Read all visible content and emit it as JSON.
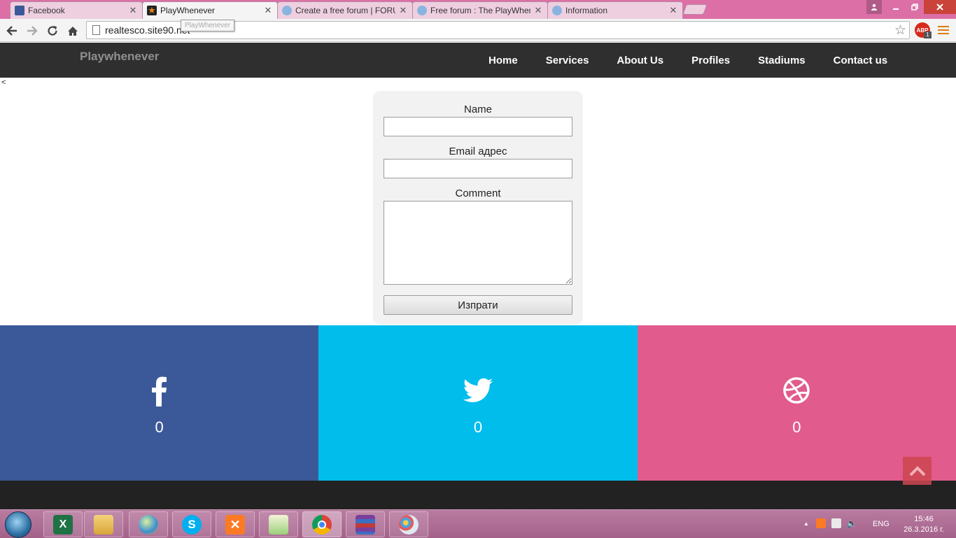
{
  "browser": {
    "tabs": [
      {
        "title": "Facebook",
        "icon": "facebook-favicon"
      },
      {
        "title": "PlayWhenever",
        "icon": "star-favicon",
        "active": true
      },
      {
        "title": "Create a free forum | FORUMOTION",
        "icon": "forum-favicon"
      },
      {
        "title": "Free forum : The PlayWhenever",
        "icon": "forum-favicon"
      },
      {
        "title": "Information",
        "icon": "forum-favicon"
      }
    ],
    "close_glyph": "✕",
    "url": "realtesco.site90.net",
    "tooltip": "PlayWhenever",
    "abp_label": "ABP",
    "abp_count": "1"
  },
  "site": {
    "brand": "Playwhenever",
    "nav": [
      "Home",
      "Services",
      "About Us",
      "Profiles",
      "Stadiums",
      "Contact us"
    ],
    "stray_char": "<",
    "form": {
      "name_label": "Name",
      "name_value": "",
      "email_label": "Email адрес",
      "email_value": "",
      "comment_label": "Comment",
      "comment_value": "",
      "submit_label": "Изпрати"
    },
    "social": [
      {
        "network": "facebook",
        "icon": "facebook-icon",
        "count": "0",
        "color": "#3b5998"
      },
      {
        "network": "twitter",
        "icon": "twitter-icon",
        "count": "0",
        "color": "#00bdec"
      },
      {
        "network": "dribbble",
        "icon": "dribbble-icon",
        "count": "0",
        "color": "#e15b8c"
      }
    ]
  },
  "taskbar": {
    "apps": [
      "Excel",
      "File Explorer",
      "Planet app",
      "Skype",
      "XAMPP",
      "Notepad++",
      "Google Chrome",
      "WinRAR",
      "Paint"
    ],
    "lang": "ENG",
    "time": "15:46",
    "date": "26.3.2016 г."
  }
}
